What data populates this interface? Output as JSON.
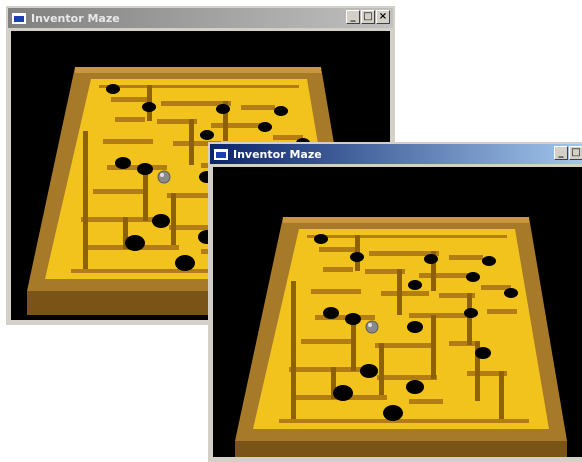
{
  "windows": [
    {
      "title": "Inventor Maze",
      "state": "inactive",
      "controls": {
        "minimize": "_",
        "maximize": "□",
        "close": "×"
      }
    },
    {
      "title": "Inventor Maze",
      "state": "active",
      "controls": {
        "minimize": "_",
        "maximize": "□",
        "close": "×"
      }
    }
  ],
  "colors": {
    "maze_floor": "#f2c31c",
    "maze_frame": "#a0701e",
    "hole": "#000000",
    "ball": "#8a8a8a",
    "viewport_bg": "#000000"
  }
}
